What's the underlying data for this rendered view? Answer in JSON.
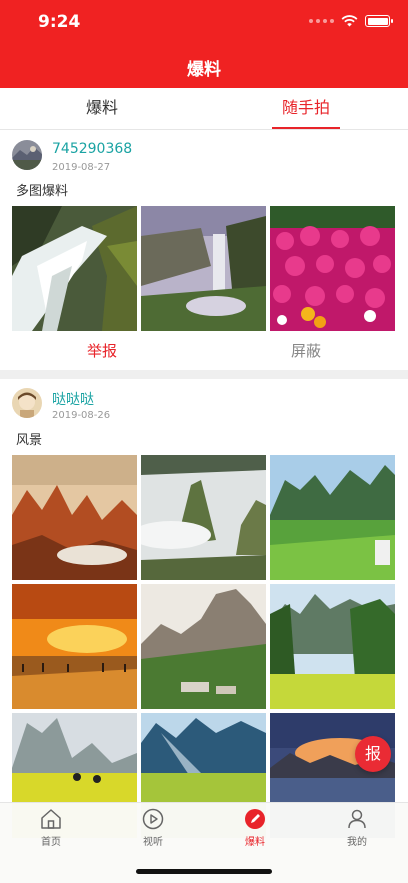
{
  "status_bar": {
    "time": "9:24"
  },
  "nav": {
    "title": "爆料"
  },
  "tabs": [
    {
      "label": "爆料",
      "active": false
    },
    {
      "label": "随手拍",
      "active": true
    }
  ],
  "posts": [
    {
      "username": "745290368",
      "date": "2019-08-27",
      "text": "多图爆料",
      "photos": [
        "waterfall-cascade-photo",
        "waterfall-valley-photo",
        "pink-flowers-photo"
      ],
      "actions": {
        "report": "举报",
        "block": "屏蔽"
      }
    },
    {
      "username": "哒哒哒",
      "date": "2019-08-26",
      "text": "风景",
      "photos": [
        "red-peaks-photo",
        "misty-mountain-photo",
        "green-valley-photo",
        "sunset-beach-photo",
        "cliff-village-photo",
        "palm-rice-field-photo",
        "rapeseed-field-photo",
        "sunbeam-valley-photo",
        "dusk-lake-photo"
      ]
    }
  ],
  "fab": {
    "label": "报"
  },
  "tabbar": [
    {
      "label": "首页",
      "icon": "home-icon"
    },
    {
      "label": "视听",
      "icon": "play-icon"
    },
    {
      "label": "爆料",
      "icon": "pen-icon",
      "active": true
    },
    {
      "label": "我的",
      "icon": "user-icon"
    }
  ],
  "colors": {
    "header_red": "#f02222",
    "accent_red": "#e8242a",
    "username_teal": "#1aa3a3",
    "divider_gray": "#efefef"
  }
}
